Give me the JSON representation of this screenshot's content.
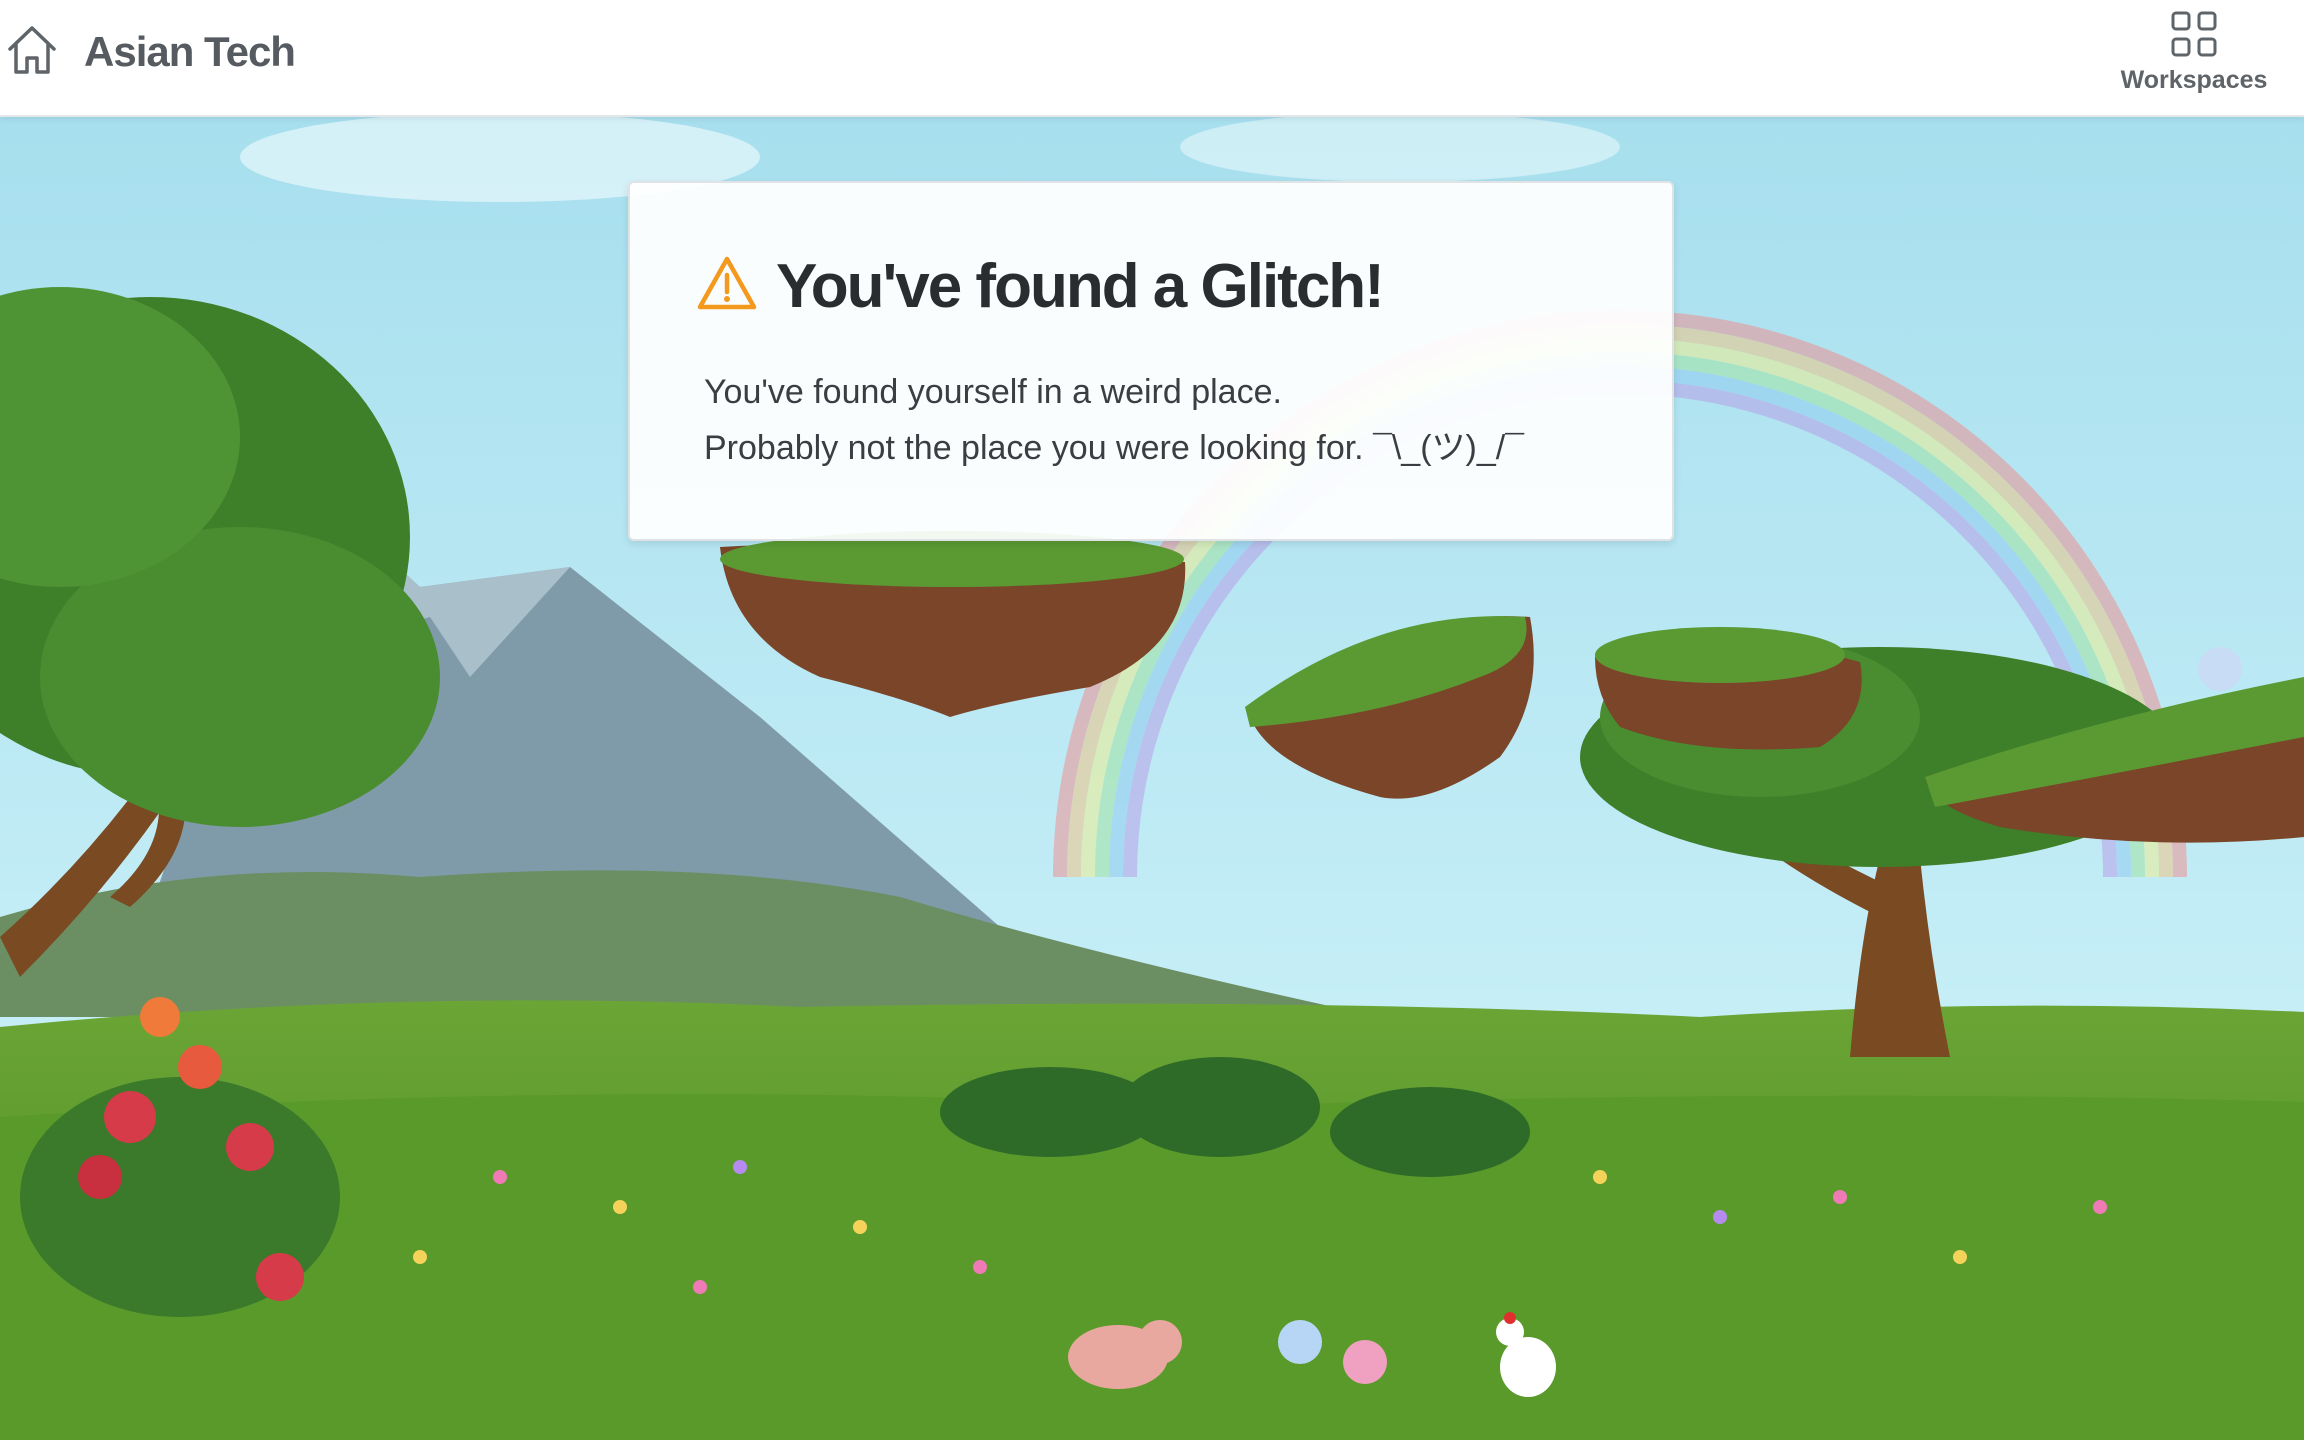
{
  "header": {
    "title": "Asian Tech",
    "home_icon": "home-icon",
    "workspaces_label": "Workspaces",
    "workspaces_icon": "grid-icon"
  },
  "error_card": {
    "icon": "warning-icon",
    "heading": "You've found a Glitch!",
    "line1": "You've found yourself in a weird place.",
    "line2": "Probably not the place you were looking for. ¯\\_(ツ)_/¯"
  },
  "colors": {
    "warning": "#f39a1e",
    "sky": "#bde9f2",
    "grass": "#5c9a2c"
  }
}
